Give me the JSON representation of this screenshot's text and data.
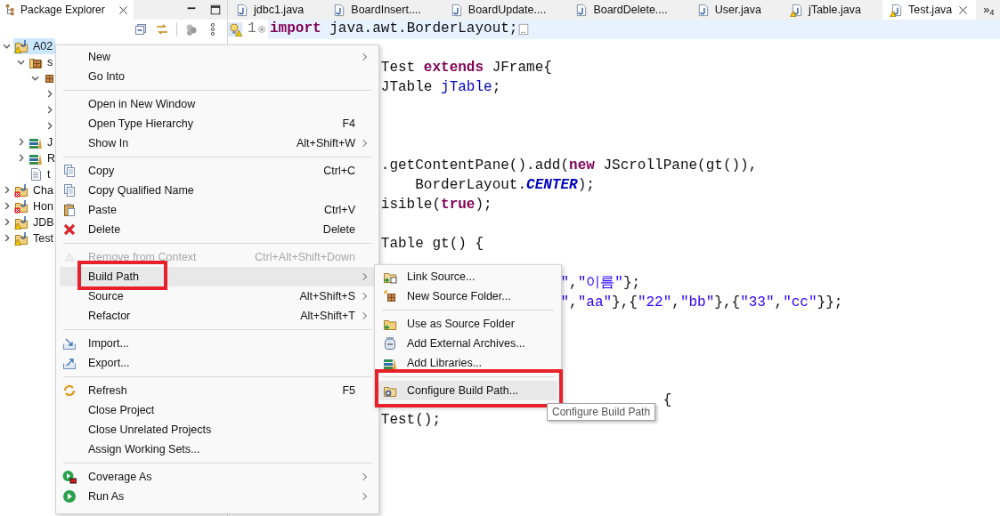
{
  "package_explorer": {
    "title": "Package Explorer",
    "tree": [
      {
        "label": "A02",
        "kind": "project",
        "warning": true,
        "error": false,
        "expanded": true,
        "selected": true,
        "children": [
          {
            "label": "s",
            "kind": "source-folder",
            "expanded": true,
            "selected": false,
            "children": [
              {
                "kind": "package",
                "expanded": true,
                "selected": false,
                "children": [
                  {
                    "expanded": false,
                    "selected": false
                  },
                  {
                    "expanded": false,
                    "selected": false
                  },
                  {
                    "expanded": false,
                    "selected": false
                  }
                ]
              }
            ]
          },
          {
            "label": "J",
            "kind": "library",
            "expanded": false,
            "selected": false
          },
          {
            "label": "R",
            "kind": "library",
            "expanded": false,
            "selected": false
          },
          {
            "label": "t",
            "kind": "file",
            "selected": false
          }
        ]
      },
      {
        "label": "Cha",
        "kind": "project",
        "warning": false,
        "error": true,
        "expanded": false,
        "selected": false
      },
      {
        "label": "Hon",
        "kind": "project",
        "warning": false,
        "error": true,
        "expanded": false,
        "selected": false
      },
      {
        "label": "JDB",
        "kind": "project",
        "warning": true,
        "error": false,
        "expanded": false,
        "selected": false
      },
      {
        "label": "Test",
        "kind": "project",
        "warning": true,
        "error": false,
        "expanded": false,
        "selected": false
      }
    ]
  },
  "editor": {
    "tabs": [
      {
        "label": "jdbc1.java",
        "selected": false,
        "warning": false
      },
      {
        "label": "BoardInsert....",
        "selected": false,
        "warning": false
      },
      {
        "label": "BoardUpdate....",
        "selected": false,
        "warning": false
      },
      {
        "label": "BoardDelete....",
        "selected": false,
        "warning": false
      },
      {
        "label": "User.java",
        "selected": false,
        "warning": false
      },
      {
        "label": "jTable.java",
        "selected": false,
        "warning": true
      },
      {
        "label": "Test.java",
        "selected": true,
        "warning": true
      }
    ],
    "overflow": "»$_{4}$",
    "lines": [
      {
        "number": "1",
        "warning": true,
        "folded": true,
        "current": true,
        "segments": [
          {
            "kind": "keyword",
            "text": "import"
          },
          {
            "kind": "plain",
            "text": " java.awt.BorderLayout;"
          }
        ]
      },
      {
        "segments": [
          {
            "kind": "plain",
            "text": "             Test "
          },
          {
            "kind": "keyword",
            "text": "extends"
          },
          {
            "kind": "plain",
            "text": " JFrame{"
          }
        ]
      },
      {
        "segments": [
          {
            "kind": "plain",
            "text": "             JTable "
          },
          {
            "kind": "field",
            "text": "jTable"
          },
          {
            "kind": "plain",
            "text": ";"
          }
        ]
      },
      {
        "segments": [
          {
            "kind": "plain",
            "text": "             .getContentPane().add("
          },
          {
            "kind": "keyword",
            "text": "new"
          },
          {
            "kind": "plain",
            "text": " JScrollPane(gt()),"
          }
        ]
      },
      {
        "segments": [
          {
            "kind": "plain",
            "text": "                 BorderLayout."
          },
          {
            "kind": "constant",
            "text": "CENTER"
          },
          {
            "kind": "plain",
            "text": ");"
          }
        ]
      },
      {
        "segments": [
          {
            "kind": "plain",
            "text": "             isible("
          },
          {
            "kind": "keyword",
            "text": "true"
          },
          {
            "kind": "plain",
            "text": ");"
          }
        ]
      },
      {
        "segments": [
          {
            "kind": "plain",
            "text": "             Table gt() {"
          }
        ]
      },
      {
        "segments": [
          {
            "kind": "string",
            "text": "                                  \""
          },
          {
            "kind": "plain",
            "text": ","
          },
          {
            "kind": "string",
            "text": "\"이름\""
          },
          {
            "kind": "plain",
            "text": "};"
          }
        ]
      },
      {
        "segments": [
          {
            "kind": "string",
            "text": "                                  \""
          },
          {
            "kind": "plain",
            "text": ","
          },
          {
            "kind": "string",
            "text": "\"aa\""
          },
          {
            "kind": "plain",
            "text": "},{"
          },
          {
            "kind": "string",
            "text": "\"22\""
          },
          {
            "kind": "plain",
            "text": ","
          },
          {
            "kind": "string",
            "text": "\"bb\""
          },
          {
            "kind": "plain",
            "text": "},{"
          },
          {
            "kind": "string",
            "text": "\"33\""
          },
          {
            "kind": "plain",
            "text": ","
          },
          {
            "kind": "string",
            "text": "\"cc\""
          },
          {
            "kind": "plain",
            "text": "}};"
          }
        ]
      },
      {
        "segments": [
          {
            "kind": "plain",
            "text": "                                              {"
          }
        ]
      },
      {
        "segments": [
          {
            "kind": "plain",
            "text": "             Test();"
          }
        ]
      }
    ]
  },
  "context_menu": {
    "items": [
      {
        "kind": "item",
        "label": "New",
        "selected": false,
        "submenu": true
      },
      {
        "kind": "item",
        "label": "Go Into",
        "selected": false
      },
      {
        "kind": "separator"
      },
      {
        "kind": "item",
        "label": "Open in New Window",
        "selected": false
      },
      {
        "kind": "item",
        "label": "Open Type Hierarchy",
        "shortcut": "F4",
        "selected": false
      },
      {
        "kind": "item",
        "label": "Show In",
        "shortcut": "Alt+Shift+W",
        "selected": false,
        "submenu": true
      },
      {
        "kind": "separator"
      },
      {
        "kind": "item",
        "label": "Copy",
        "shortcut": "Ctrl+C",
        "selected": false
      },
      {
        "kind": "item",
        "label": "Copy Qualified Name",
        "selected": false
      },
      {
        "kind": "item",
        "label": "Paste",
        "shortcut": "Ctrl+V",
        "selected": false
      },
      {
        "kind": "item",
        "label": "Delete",
        "shortcut": "Delete",
        "selected": false
      },
      {
        "kind": "separator"
      },
      {
        "kind": "item",
        "label": "Remove from Context",
        "shortcut": "Ctrl+Alt+Shift+Down",
        "selected": false,
        "disabled": true
      },
      {
        "kind": "item",
        "label": "Build Path",
        "selected": true,
        "submenu": true,
        "annotated": true
      },
      {
        "kind": "item",
        "label": "Source",
        "shortcut": "Alt+Shift+S",
        "selected": false,
        "submenu": true
      },
      {
        "kind": "item",
        "label": "Refactor",
        "shortcut": "Alt+Shift+T",
        "selected": false,
        "submenu": true
      },
      {
        "kind": "separator"
      },
      {
        "kind": "item",
        "label": "Import...",
        "selected": false
      },
      {
        "kind": "item",
        "label": "Export...",
        "selected": false
      },
      {
        "kind": "separator"
      },
      {
        "kind": "item",
        "label": "Refresh",
        "shortcut": "F5",
        "selected": false
      },
      {
        "kind": "item",
        "label": "Close Project",
        "selected": false
      },
      {
        "kind": "item",
        "label": "Close Unrelated Projects",
        "selected": false
      },
      {
        "kind": "item",
        "label": "Assign Working Sets...",
        "selected": false
      },
      {
        "kind": "separator"
      },
      {
        "kind": "item",
        "label": "Coverage As",
        "selected": false,
        "submenu": true
      },
      {
        "kind": "item",
        "label": "Run As",
        "selected": false,
        "submenu": true
      }
    ]
  },
  "submenu": {
    "items": [
      {
        "kind": "item",
        "label": "Link Source...",
        "selected": false
      },
      {
        "kind": "item",
        "label": "New Source Folder...",
        "selected": false
      },
      {
        "kind": "separator"
      },
      {
        "kind": "item",
        "label": "Use as Source Folder",
        "selected": false
      },
      {
        "kind": "item",
        "label": "Add External Archives...",
        "selected": false
      },
      {
        "kind": "item",
        "label": "Add Libraries...",
        "selected": false
      },
      {
        "kind": "separator"
      },
      {
        "kind": "item",
        "label": "Configure Build Path...",
        "selected": true,
        "annotated": true
      }
    ]
  },
  "tooltip": "Configure Build Path"
}
